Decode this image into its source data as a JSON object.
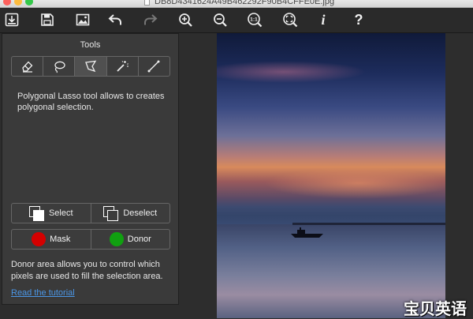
{
  "window": {
    "title": "DB8D4341624A49B462292F90B4CFFE0E.jpg"
  },
  "toolbar": {
    "buttons": [
      {
        "name": "open",
        "icon": "open-file-icon"
      },
      {
        "name": "save",
        "icon": "save-icon"
      },
      {
        "name": "open-image",
        "icon": "image-icon"
      },
      {
        "name": "undo",
        "icon": "undo-icon"
      },
      {
        "name": "redo",
        "icon": "redo-icon"
      },
      {
        "name": "zoom-in",
        "icon": "zoom-in-icon"
      },
      {
        "name": "zoom-out",
        "icon": "zoom-out-icon"
      },
      {
        "name": "actual-size",
        "icon": "zoom-actual-size-icon",
        "label": "1:1"
      },
      {
        "name": "fit",
        "icon": "zoom-fit-icon"
      },
      {
        "name": "info",
        "icon": "info-icon",
        "label": "i"
      },
      {
        "name": "help",
        "icon": "help-icon",
        "label": "?"
      }
    ]
  },
  "panel": {
    "title": "Tools",
    "tools": [
      {
        "name": "eraser",
        "icon": "eraser-icon"
      },
      {
        "name": "lasso",
        "icon": "lasso-icon"
      },
      {
        "name": "polygonal-lasso",
        "icon": "polygonal-lasso-icon",
        "active": true
      },
      {
        "name": "magic-wand",
        "icon": "magic-wand-icon"
      },
      {
        "name": "line",
        "icon": "line-icon"
      }
    ],
    "tool_description": "Polygonal Lasso tool allows to creates polygonal selection.",
    "select_label": "Select",
    "deselect_label": "Deselect",
    "mask_label": "Mask",
    "donor_label": "Donor",
    "donor_description": "Donor area allows you to control which pixels are used to fill the selection area.",
    "tutorial_link": "Read the tutorial"
  },
  "colors": {
    "mask": "#d40000",
    "donor": "#10a010",
    "link": "#4b96e6"
  },
  "watermark": "宝贝英语"
}
